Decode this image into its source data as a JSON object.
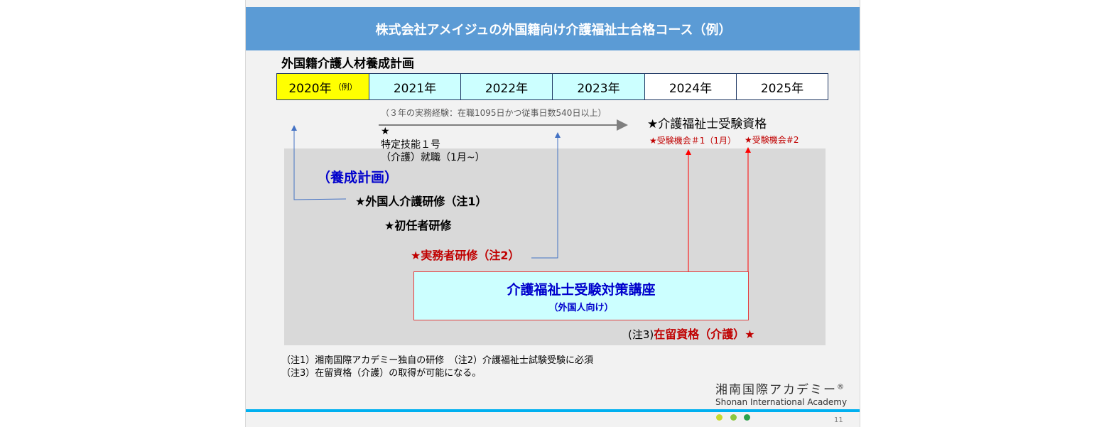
{
  "title": "株式会社アメイジュの外国籍向け介護福祉士合格コース（例）",
  "plan_heading": "外国籍介護人材養成計画",
  "years": [
    {
      "label": "2020年",
      "note": "（例）",
      "bg": "#ffff00"
    },
    {
      "label": "2021年",
      "note": "",
      "bg": "#ccffff"
    },
    {
      "label": "2022年",
      "note": "",
      "bg": "#ccffff"
    },
    {
      "label": "2023年",
      "note": "",
      "bg": "#ccffff"
    },
    {
      "label": "2024年",
      "note": "",
      "bg": "#ffffff"
    },
    {
      "label": "2025年",
      "note": "",
      "bg": "#ffffff"
    }
  ],
  "experience_note": "（３年の実務経験：在職1095日かつ従事日数540日以上）",
  "tokutei": {
    "star": "★",
    "line1": "特定技能１号",
    "line2": "（介護）就職（1月~）"
  },
  "qualification": {
    "heading": "★介護福祉士受験資格",
    "exam1": "★受験機会＃1（1月）",
    "exam2": "★受験機会#2"
  },
  "training_plan_label": "（養成計画）",
  "training_items": {
    "foreign_training": "★外国人介護研修（注1）",
    "initial_training": "★初任者研修",
    "practitioner_training": "★実務者研修（注2）"
  },
  "course_box": {
    "title": "介護福祉士受験対策講座",
    "subtitle": "（外国人向け）"
  },
  "residence": {
    "prefix": "(注3)",
    "label": "在留資格（介護）★"
  },
  "footnotes": [
    "（注1）湘南国際アカデミー独自の研修　（注2）介護福祉士試験受験に必須",
    "（注3）在留資格（介護）の取得が可能になる。"
  ],
  "academy": {
    "name_jp": "湘南国際アカデミー",
    "registered": "®",
    "name_en": "Shonan International Academy"
  },
  "page_number": "11",
  "colors": {
    "title_bar": "#5b9bd5",
    "accent_line": "#00b0f0",
    "dot1": "#c8d82c",
    "dot2": "#8cc63f",
    "dot3": "#2ca14c"
  }
}
